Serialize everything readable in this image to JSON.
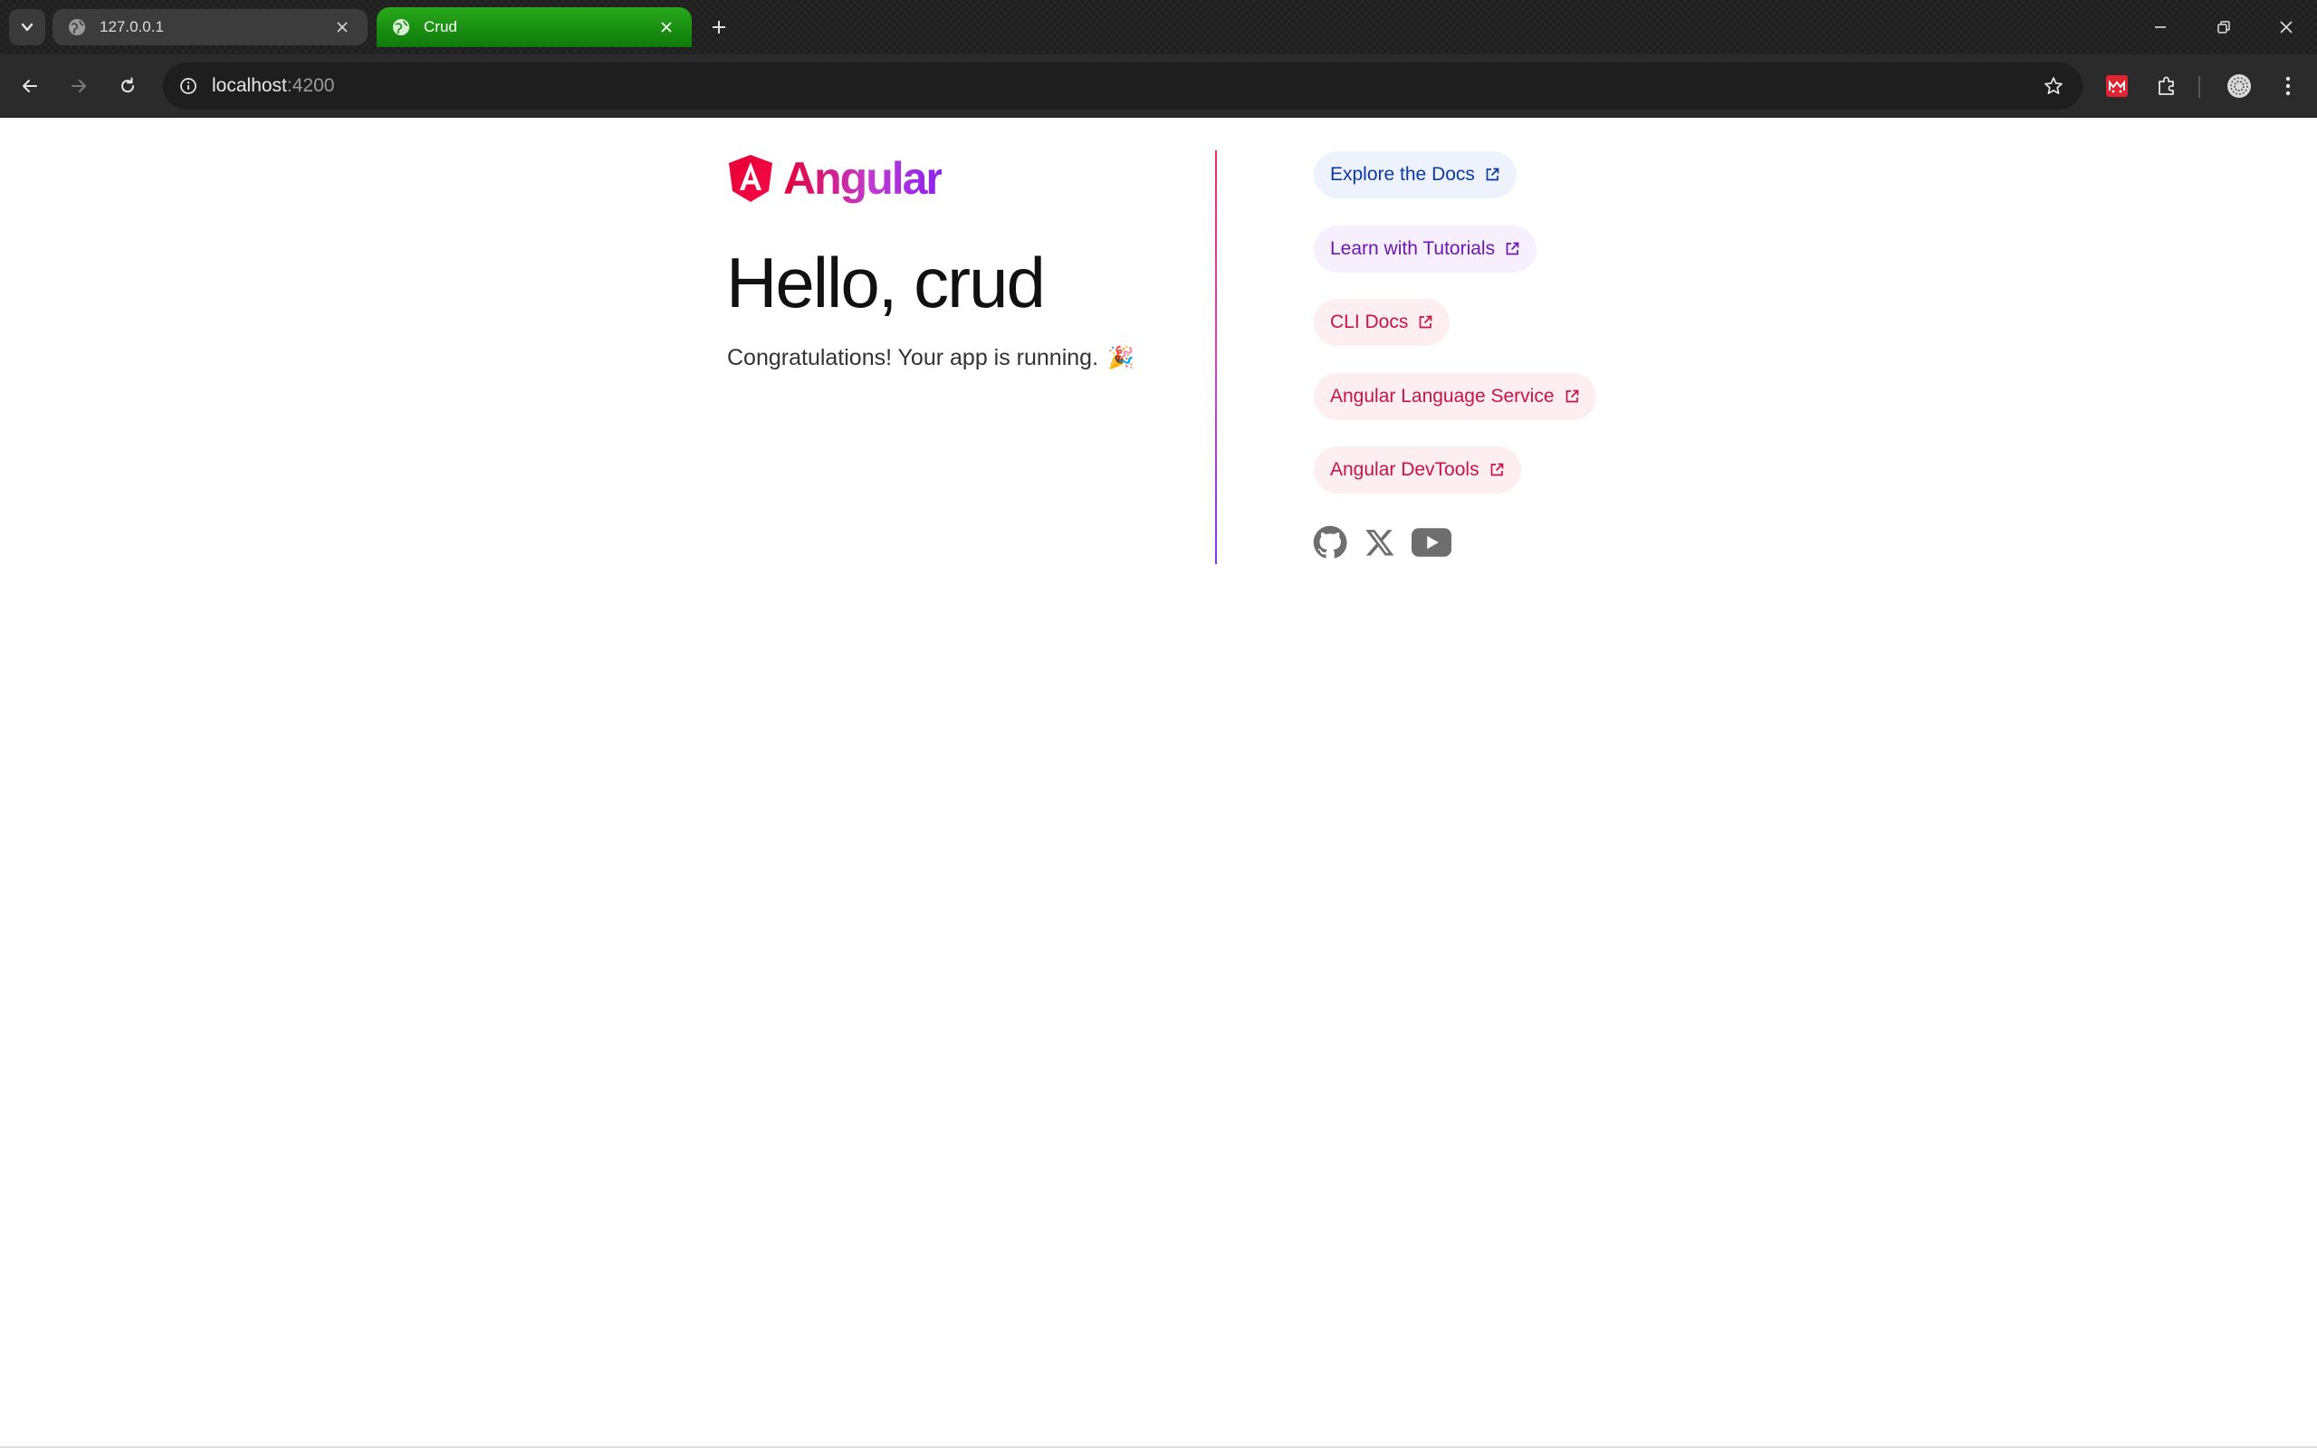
{
  "browser": {
    "tabs": [
      {
        "title": "127.0.0.1",
        "active": false
      },
      {
        "title": "Crud",
        "active": true
      }
    ],
    "address": {
      "host": "localhost",
      "port": ":4200"
    },
    "accent_active_tab": "#1a9a12"
  },
  "page": {
    "logo_text": "Angular",
    "heading": "Hello, crud",
    "subtitle": "Congratulations! Your app is running.",
    "subtitle_emoji": "🎉",
    "links": [
      {
        "label": "Explore the Docs"
      },
      {
        "label": "Learn with Tutorials"
      },
      {
        "label": "CLI Docs"
      },
      {
        "label": "Angular Language Service"
      },
      {
        "label": "Angular DevTools"
      }
    ],
    "social_icons": [
      "github-icon",
      "x-icon",
      "youtube-icon"
    ],
    "colors": {
      "brand_red": "#e40035",
      "brand_purple": "#8b22ef",
      "link_blue": "#0a3aa8",
      "link_purple": "#7016b4",
      "link_pink": "#c91446"
    }
  }
}
